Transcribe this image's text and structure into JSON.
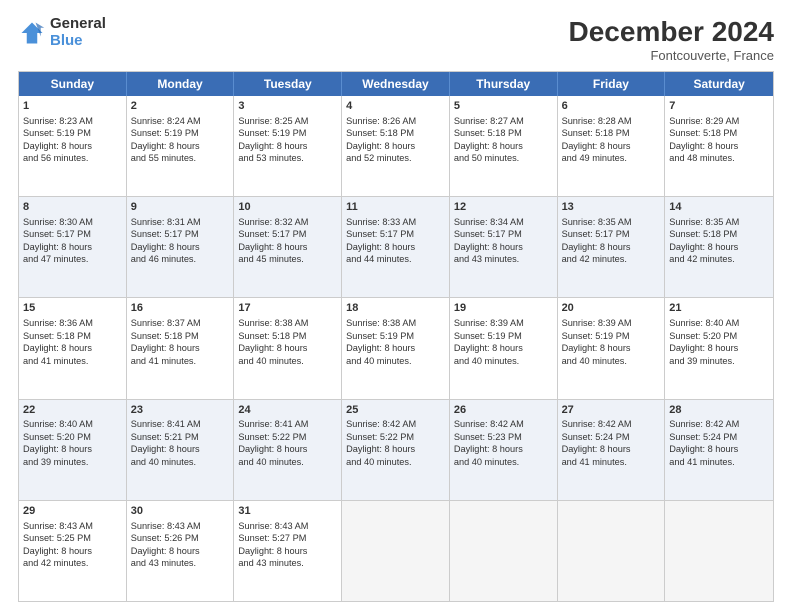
{
  "header": {
    "logo_general": "General",
    "logo_blue": "Blue",
    "month_title": "December 2024",
    "location": "Fontcouverte, France"
  },
  "weekdays": [
    "Sunday",
    "Monday",
    "Tuesday",
    "Wednesday",
    "Thursday",
    "Friday",
    "Saturday"
  ],
  "weeks": [
    [
      {
        "day": "1",
        "lines": [
          "Sunrise: 8:23 AM",
          "Sunset: 5:19 PM",
          "Daylight: 8 hours",
          "and 56 minutes."
        ]
      },
      {
        "day": "2",
        "lines": [
          "Sunrise: 8:24 AM",
          "Sunset: 5:19 PM",
          "Daylight: 8 hours",
          "and 55 minutes."
        ]
      },
      {
        "day": "3",
        "lines": [
          "Sunrise: 8:25 AM",
          "Sunset: 5:19 PM",
          "Daylight: 8 hours",
          "and 53 minutes."
        ]
      },
      {
        "day": "4",
        "lines": [
          "Sunrise: 8:26 AM",
          "Sunset: 5:18 PM",
          "Daylight: 8 hours",
          "and 52 minutes."
        ]
      },
      {
        "day": "5",
        "lines": [
          "Sunrise: 8:27 AM",
          "Sunset: 5:18 PM",
          "Daylight: 8 hours",
          "and 50 minutes."
        ]
      },
      {
        "day": "6",
        "lines": [
          "Sunrise: 8:28 AM",
          "Sunset: 5:18 PM",
          "Daylight: 8 hours",
          "and 49 minutes."
        ]
      },
      {
        "day": "7",
        "lines": [
          "Sunrise: 8:29 AM",
          "Sunset: 5:18 PM",
          "Daylight: 8 hours",
          "and 48 minutes."
        ]
      }
    ],
    [
      {
        "day": "8",
        "lines": [
          "Sunrise: 8:30 AM",
          "Sunset: 5:17 PM",
          "Daylight: 8 hours",
          "and 47 minutes."
        ]
      },
      {
        "day": "9",
        "lines": [
          "Sunrise: 8:31 AM",
          "Sunset: 5:17 PM",
          "Daylight: 8 hours",
          "and 46 minutes."
        ]
      },
      {
        "day": "10",
        "lines": [
          "Sunrise: 8:32 AM",
          "Sunset: 5:17 PM",
          "Daylight: 8 hours",
          "and 45 minutes."
        ]
      },
      {
        "day": "11",
        "lines": [
          "Sunrise: 8:33 AM",
          "Sunset: 5:17 PM",
          "Daylight: 8 hours",
          "and 44 minutes."
        ]
      },
      {
        "day": "12",
        "lines": [
          "Sunrise: 8:34 AM",
          "Sunset: 5:17 PM",
          "Daylight: 8 hours",
          "and 43 minutes."
        ]
      },
      {
        "day": "13",
        "lines": [
          "Sunrise: 8:35 AM",
          "Sunset: 5:17 PM",
          "Daylight: 8 hours",
          "and 42 minutes."
        ]
      },
      {
        "day": "14",
        "lines": [
          "Sunrise: 8:35 AM",
          "Sunset: 5:18 PM",
          "Daylight: 8 hours",
          "and 42 minutes."
        ]
      }
    ],
    [
      {
        "day": "15",
        "lines": [
          "Sunrise: 8:36 AM",
          "Sunset: 5:18 PM",
          "Daylight: 8 hours",
          "and 41 minutes."
        ]
      },
      {
        "day": "16",
        "lines": [
          "Sunrise: 8:37 AM",
          "Sunset: 5:18 PM",
          "Daylight: 8 hours",
          "and 41 minutes."
        ]
      },
      {
        "day": "17",
        "lines": [
          "Sunrise: 8:38 AM",
          "Sunset: 5:18 PM",
          "Daylight: 8 hours",
          "and 40 minutes."
        ]
      },
      {
        "day": "18",
        "lines": [
          "Sunrise: 8:38 AM",
          "Sunset: 5:19 PM",
          "Daylight: 8 hours",
          "and 40 minutes."
        ]
      },
      {
        "day": "19",
        "lines": [
          "Sunrise: 8:39 AM",
          "Sunset: 5:19 PM",
          "Daylight: 8 hours",
          "and 40 minutes."
        ]
      },
      {
        "day": "20",
        "lines": [
          "Sunrise: 8:39 AM",
          "Sunset: 5:19 PM",
          "Daylight: 8 hours",
          "and 40 minutes."
        ]
      },
      {
        "day": "21",
        "lines": [
          "Sunrise: 8:40 AM",
          "Sunset: 5:20 PM",
          "Daylight: 8 hours",
          "and 39 minutes."
        ]
      }
    ],
    [
      {
        "day": "22",
        "lines": [
          "Sunrise: 8:40 AM",
          "Sunset: 5:20 PM",
          "Daylight: 8 hours",
          "and 39 minutes."
        ]
      },
      {
        "day": "23",
        "lines": [
          "Sunrise: 8:41 AM",
          "Sunset: 5:21 PM",
          "Daylight: 8 hours",
          "and 40 minutes."
        ]
      },
      {
        "day": "24",
        "lines": [
          "Sunrise: 8:41 AM",
          "Sunset: 5:22 PM",
          "Daylight: 8 hours",
          "and 40 minutes."
        ]
      },
      {
        "day": "25",
        "lines": [
          "Sunrise: 8:42 AM",
          "Sunset: 5:22 PM",
          "Daylight: 8 hours",
          "and 40 minutes."
        ]
      },
      {
        "day": "26",
        "lines": [
          "Sunrise: 8:42 AM",
          "Sunset: 5:23 PM",
          "Daylight: 8 hours",
          "and 40 minutes."
        ]
      },
      {
        "day": "27",
        "lines": [
          "Sunrise: 8:42 AM",
          "Sunset: 5:24 PM",
          "Daylight: 8 hours",
          "and 41 minutes."
        ]
      },
      {
        "day": "28",
        "lines": [
          "Sunrise: 8:42 AM",
          "Sunset: 5:24 PM",
          "Daylight: 8 hours",
          "and 41 minutes."
        ]
      }
    ],
    [
      {
        "day": "29",
        "lines": [
          "Sunrise: 8:43 AM",
          "Sunset: 5:25 PM",
          "Daylight: 8 hours",
          "and 42 minutes."
        ]
      },
      {
        "day": "30",
        "lines": [
          "Sunrise: 8:43 AM",
          "Sunset: 5:26 PM",
          "Daylight: 8 hours",
          "and 43 minutes."
        ]
      },
      {
        "day": "31",
        "lines": [
          "Sunrise: 8:43 AM",
          "Sunset: 5:27 PM",
          "Daylight: 8 hours",
          "and 43 minutes."
        ]
      },
      null,
      null,
      null,
      null
    ]
  ]
}
